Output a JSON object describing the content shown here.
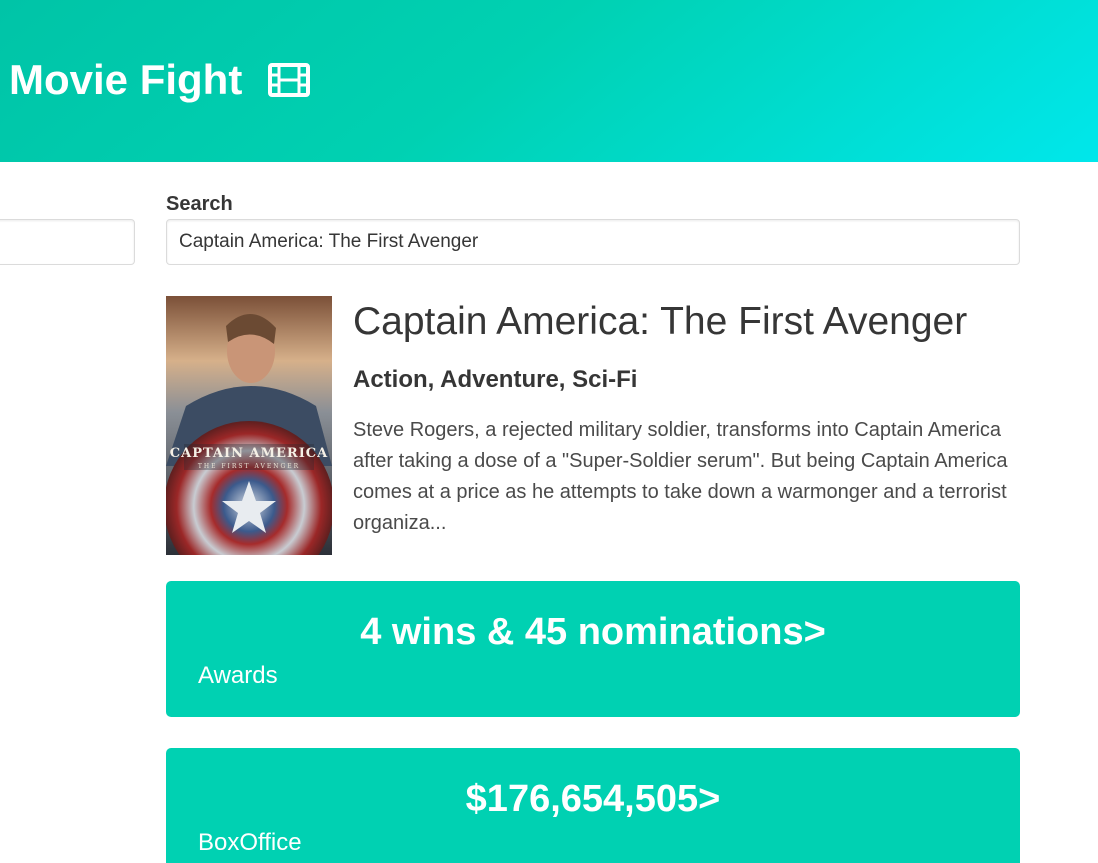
{
  "header": {
    "title": "Movie Fight",
    "icon": "film-icon",
    "gradient": [
      "#00c4a7",
      "#00d1b2",
      "#00e7eb"
    ]
  },
  "search": {
    "label": "Search",
    "value": "Captain America: The First Avenger",
    "placeholder": ""
  },
  "movie": {
    "title": "Captain America: The First Avenger",
    "genre": "Action, Adventure, Sci-Fi",
    "plot": "Steve Rogers, a rejected military soldier, transforms into Captain America after taking a dose of a \"Super-Soldier serum\". But being Captain America comes at a price as he attempts to take down a warmonger and a terrorist organiza...",
    "poster": {
      "title_text": "CAPTAIN AMERICA",
      "subtitle_text": "THE FIRST AVENGER"
    }
  },
  "stats": [
    {
      "value": "4 wins & 45 nominations>",
      "label": "Awards"
    },
    {
      "value": "$176,654,505>",
      "label": "BoxOffice"
    }
  ],
  "colors": {
    "accent": "#00d1b2",
    "text": "#363636"
  }
}
